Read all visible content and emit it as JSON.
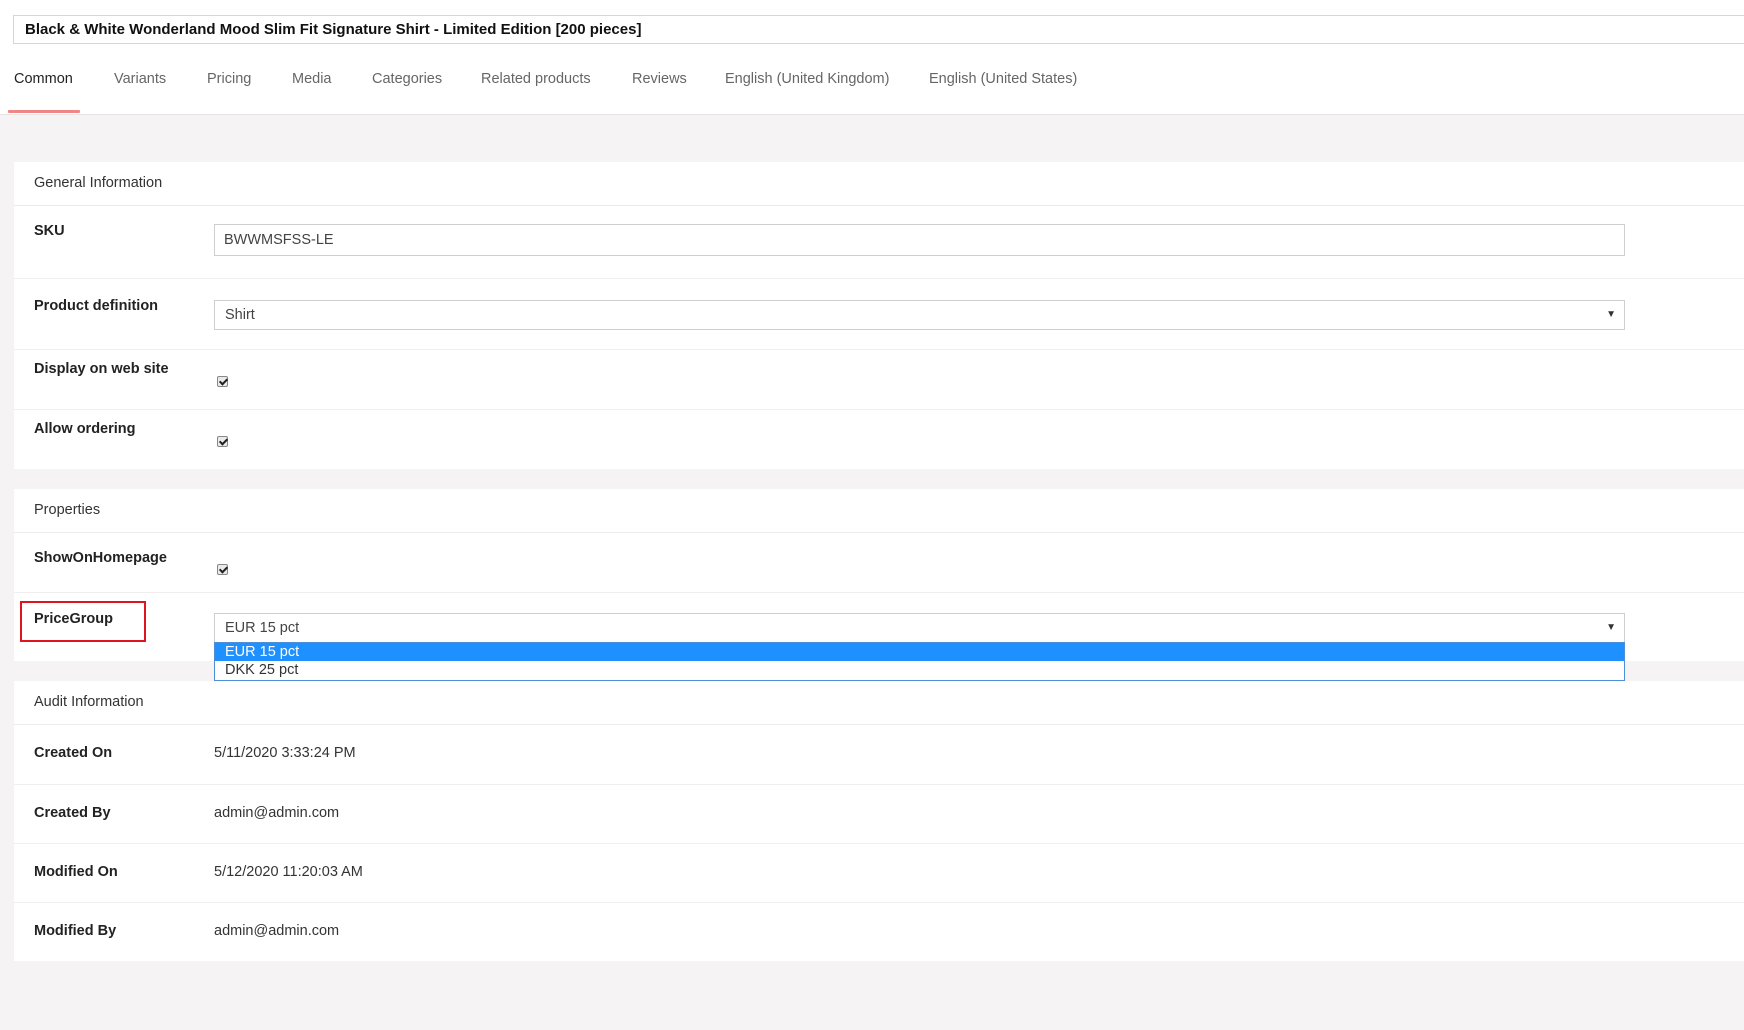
{
  "product": {
    "title": "Black & White Wonderland Mood Slim Fit Signature Shirt - Limited Edition [200 pieces]"
  },
  "tabs": [
    {
      "label": "Common",
      "active": true
    },
    {
      "label": "Variants"
    },
    {
      "label": "Pricing"
    },
    {
      "label": "Media"
    },
    {
      "label": "Categories"
    },
    {
      "label": "Related products"
    },
    {
      "label": "Reviews"
    },
    {
      "label": "English (United Kingdom)"
    },
    {
      "label": "English (United States)"
    }
  ],
  "general": {
    "header": "General Information",
    "sku": {
      "label": "SKU",
      "value": "BWWMSFSS-LE"
    },
    "product_definition": {
      "label": "Product definition",
      "value": "Shirt"
    },
    "display_on_web_site": {
      "label": "Display on web site",
      "checked": true
    },
    "allow_ordering": {
      "label": "Allow ordering",
      "checked": true
    }
  },
  "properties": {
    "header": "Properties",
    "show_on_homepage": {
      "label": "ShowOnHomepage",
      "checked": true
    },
    "price_group": {
      "label": "PriceGroup",
      "value": "EUR 15 pct",
      "options": [
        "EUR 15 pct",
        "DKK 25 pct"
      ],
      "selected_index": 0
    }
  },
  "audit": {
    "header": "Audit Information",
    "created_on": {
      "label": "Created On",
      "value": "5/11/2020 3:33:24 PM"
    },
    "created_by": {
      "label": "Created By",
      "value": "admin@admin.com"
    },
    "modified_on": {
      "label": "Modified On",
      "value": "5/12/2020 11:20:03 AM"
    },
    "modified_by": {
      "label": "Modified By",
      "value": "admin@admin.com"
    }
  },
  "colors": {
    "tab_underline": "#f08585",
    "highlight_border": "#e0141e",
    "dropdown_selected": "#1e90ff"
  }
}
